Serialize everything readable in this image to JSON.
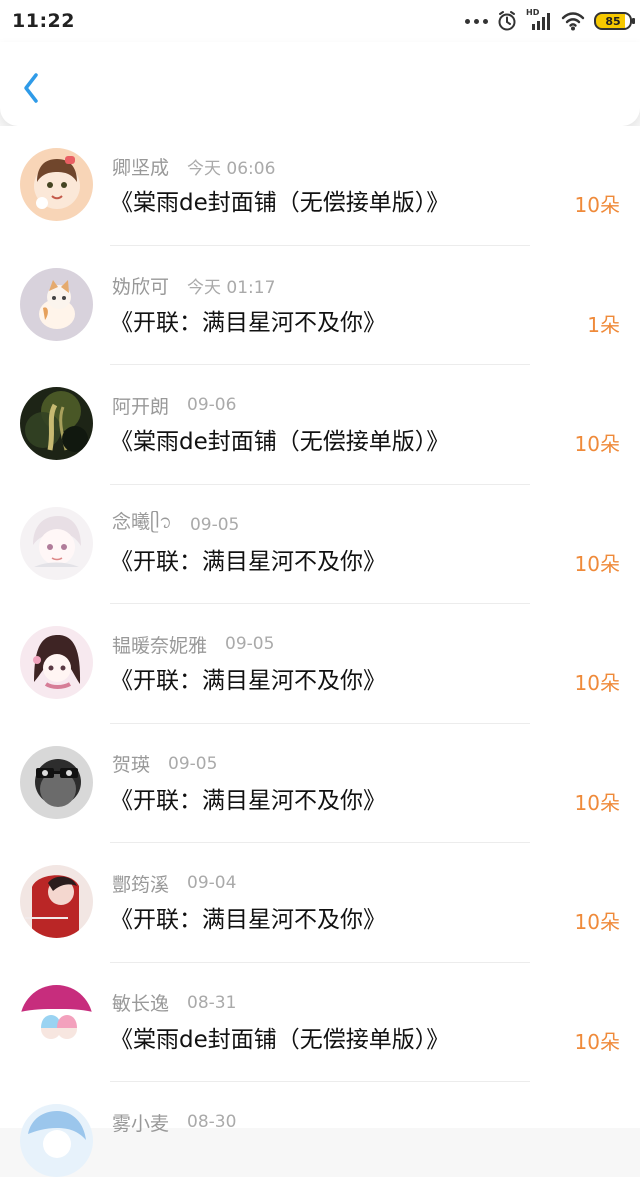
{
  "status": {
    "time": "11:22",
    "battery": "85",
    "signal_label": "HD"
  },
  "navigation": {
    "back_label": "<"
  },
  "items": [
    {
      "name": "卿坚成",
      "time": "今天 06:06",
      "title": "《棠雨de封面铺（无偿接单版）》",
      "amount": "10朵"
    },
    {
      "name": "妫欣可",
      "time": "今天 01:17",
      "title": "《开联：满目星河不及你》",
      "amount": "1朵"
    },
    {
      "name": "阿开朗",
      "time": "09-06",
      "title": "《棠雨de封面铺（无偿接单版）》",
      "amount": "10朵"
    },
    {
      "name": "念曦ᥫ᭡",
      "time": "09-05",
      "title": "《开联：满目星河不及你》",
      "amount": "10朵"
    },
    {
      "name": "韫暖奈妮雅",
      "time": "09-05",
      "title": "《开联：满目星河不及你》",
      "amount": "10朵"
    },
    {
      "name": "贺瑛",
      "time": "09-05",
      "title": "《开联：满目星河不及你》",
      "amount": "10朵"
    },
    {
      "name": "酆筠溪",
      "time": "09-04",
      "title": "《开联：满目星河不及你》",
      "amount": "10朵"
    },
    {
      "name": "敏长逸",
      "time": "08-31",
      "title": "《棠雨de封面铺（无偿接单版）》",
      "amount": "10朵"
    },
    {
      "name": "雾小麦",
      "time": "08-30",
      "title": "",
      "amount": ""
    }
  ]
}
